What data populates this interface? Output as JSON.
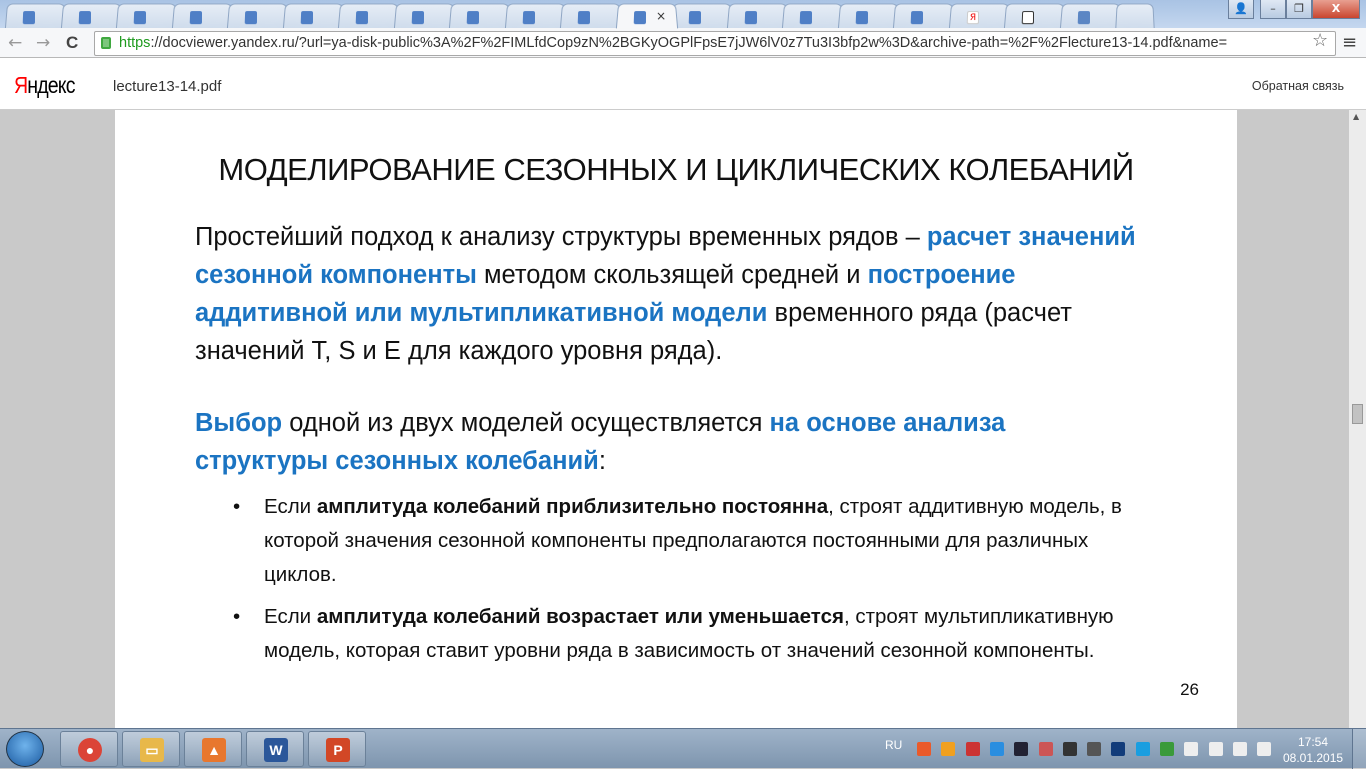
{
  "browser": {
    "tabs": [
      {
        "icon": "doc-icon"
      },
      {
        "icon": "doc-icon"
      },
      {
        "icon": "doc-icon"
      },
      {
        "icon": "doc-icon"
      },
      {
        "icon": "doc-icon"
      },
      {
        "icon": "doc-icon"
      },
      {
        "icon": "doc-icon"
      },
      {
        "icon": "doc-icon"
      },
      {
        "icon": "doc-icon"
      },
      {
        "icon": "doc-icon"
      },
      {
        "icon": "doc-icon"
      },
      {
        "icon": "doc-icon",
        "active": true,
        "close": "×"
      },
      {
        "icon": "doc-icon"
      },
      {
        "icon": "doc-icon"
      },
      {
        "icon": "doc-icon"
      },
      {
        "icon": "doc-icon"
      },
      {
        "icon": "doc-icon"
      },
      {
        "icon": "yandex-icon",
        "glyph": "Я"
      },
      {
        "icon": "chart-icon"
      },
      {
        "icon": "chat-icon"
      }
    ],
    "url_scheme": "https",
    "url_rest": "://docviewer.yandex.ru/?url=ya-disk-public%3A%2F%2FIMLfdCop9zN%2BGKyOGPlFpsE7jJW6lV0z7Tu3I3bfp2w%3D&archive-path=%2F%2Flecture13-14.pdf&name=",
    "back": "←",
    "forward": "→",
    "reload": "C",
    "star": "☆",
    "menu": "≡",
    "window": {
      "user": "👤",
      "minimize": "–",
      "restore": "❐",
      "close": "X"
    }
  },
  "header": {
    "logo_first": "Я",
    "logo_rest": "ндекс",
    "filename": "lecture13-14.pdf",
    "feedback": "Обратная связь"
  },
  "slide": {
    "title": "МОДЕЛИРОВАНИЕ СЕЗОННЫХ И ЦИКЛИЧЕСКИХ КОЛЕБАНИЙ",
    "p1": {
      "t1": "Простейший подход к анализу структуры временных рядов – ",
      "b1": "расчет значений сезонной компоненты",
      "t2": " методом скользящей средней и ",
      "b2": "построение аддитивной или мультипликативной модели",
      "t3": " временного ряда (расчет значений T, S и E для каждого уровня ряда)."
    },
    "p2": {
      "b1": "Выбор",
      "t1": " одной из двух моделей осуществляется ",
      "b2": "на основе анализа структуры сезонных колебаний",
      "t2": ":"
    },
    "bullets": [
      {
        "t1": "Если ",
        "b": "амплитуда колебаний приблизительно постоянна",
        "t2": ", строят аддитивную модель, в которой значения сезонной компоненты предполагаются постоянными для различных циклов."
      },
      {
        "t1": "Если ",
        "b": "амплитуда колебаний возрастает или уменьшается",
        "t2": ", строят мультипликативную модель, которая ставит уровни ряда в зависимость от значений сезонной компоненты."
      }
    ],
    "page_number": "26"
  },
  "taskbar": {
    "apps": [
      {
        "name": "chrome",
        "color": "#db4437",
        "glyph": "●"
      },
      {
        "name": "explorer",
        "color": "#e8b84a",
        "glyph": "▭"
      },
      {
        "name": "app",
        "color": "#e8772e",
        "glyph": "▲"
      },
      {
        "name": "word",
        "color": "#2b579a",
        "glyph": "W"
      },
      {
        "name": "powerpoint",
        "color": "#d24726",
        "glyph": "P"
      }
    ],
    "lang": "RU",
    "time": "17:54",
    "date": "08.01.2015"
  }
}
